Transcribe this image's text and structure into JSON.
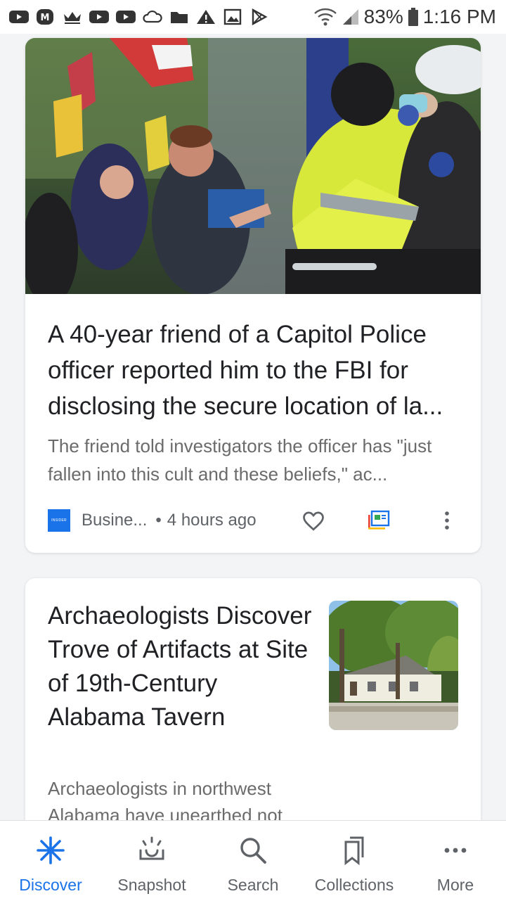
{
  "status_bar": {
    "battery": "83%",
    "time": "1:16 PM",
    "notification_icons": [
      "youtube-icon",
      "m-app-icon",
      "crown-icon",
      "youtube-icon",
      "youtube-icon",
      "cloud-icon",
      "folder-icon",
      "warning-icon",
      "image-icon",
      "play-store-icon"
    ]
  },
  "feed": {
    "card1": {
      "headline": "A 40-year friend of a Capitol Police officer reported him to the FBI for disclosing the secure location of la...",
      "snippet": "The friend told investigators the officer has \"just fallen into this cult and these beliefs,\" ac...",
      "source_logo_text": "INSIDER",
      "source": "Busine...",
      "separator": "•",
      "time": "4 hours ago"
    },
    "card2": {
      "headline": "Archaeologists Discover Trove of Artifacts at Site of 19th-Century Alabama Tavern",
      "snippet": "Archaeologists in northwest Alabama have unearthed not"
    }
  },
  "bottom_nav": {
    "items": [
      {
        "label": "Discover",
        "icon": "discover-icon",
        "active": true
      },
      {
        "label": "Snapshot",
        "icon": "snapshot-icon",
        "active": false
      },
      {
        "label": "Search",
        "icon": "search-icon",
        "active": false
      },
      {
        "label": "Collections",
        "icon": "collections-icon",
        "active": false
      },
      {
        "label": "More",
        "icon": "more-icon",
        "active": false
      }
    ]
  },
  "colors": {
    "accent": "#1a73e8",
    "text_primary": "#202124",
    "text_secondary": "#6b6b6b",
    "background": "#f3f4f6"
  }
}
